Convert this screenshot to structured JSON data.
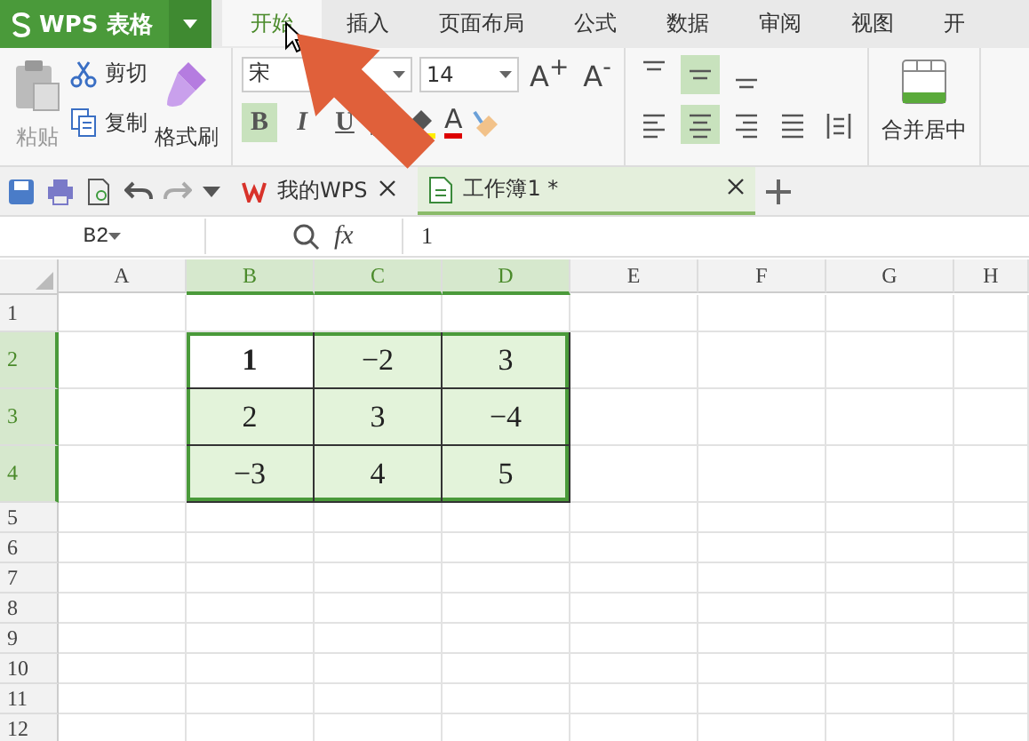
{
  "app": {
    "title": "WPS 表格"
  },
  "ribbon_tabs": [
    {
      "label": "开始",
      "selected": true
    },
    {
      "label": "插入",
      "selected": false
    },
    {
      "label": "页面布局",
      "selected": false
    },
    {
      "label": "公式",
      "selected": false
    },
    {
      "label": "数据",
      "selected": false
    },
    {
      "label": "审阅",
      "selected": false
    },
    {
      "label": "视图",
      "selected": false
    },
    {
      "label": "开",
      "selected": false
    }
  ],
  "clipboard": {
    "paste": "粘贴",
    "cut": "剪切",
    "copy": "复制",
    "format_painter": "格式刷"
  },
  "font": {
    "name": "宋",
    "size": "14",
    "grow": "A$^{+}$",
    "shrink": "A$^{-}$",
    "color_label": "A",
    "styles": [
      {
        "label": "B",
        "selected": true
      },
      {
        "label": "I",
        "selected": false
      },
      {
        "label": "U",
        "selected": false
      }
    ]
  },
  "alignment": {
    "vertical": [
      {
        "kind": "top",
        "selected": false
      },
      {
        "kind": "middle",
        "selected": true
      },
      {
        "kind": "bottom",
        "selected": false
      }
    ],
    "horizontal": [
      {
        "kind": "left",
        "selected": false
      },
      {
        "kind": "center",
        "selected": true
      },
      {
        "kind": "right",
        "selected": false
      },
      {
        "kind": "justify",
        "selected": false
      },
      {
        "kind": "distributed",
        "selected": false
      }
    ]
  },
  "merge": {
    "label": "合并居中"
  },
  "document_tabs": [
    {
      "label": "我的WPS",
      "selected": false
    },
    {
      "label": "工作簿1 *",
      "selected": true
    }
  ],
  "formula_bar": {
    "name_box": "B2",
    "fx": "fx",
    "value": "1"
  },
  "sheet": {
    "columns": [
      {
        "label": "A",
        "selected": false
      },
      {
        "label": "B",
        "selected": true
      },
      {
        "label": "C",
        "selected": true
      },
      {
        "label": "D",
        "selected": true
      },
      {
        "label": "E",
        "selected": false
      },
      {
        "label": "F",
        "selected": false
      },
      {
        "label": "G",
        "selected": false
      },
      {
        "label": "H",
        "selected": false
      }
    ],
    "rows": [
      {
        "label": "1",
        "selected": false
      },
      {
        "label": "2",
        "selected": true,
        "cells": [
          null,
          {
            "value": "1",
            "active": true
          },
          {
            "value": "−2",
            "active": false
          },
          {
            "value": "3",
            "active": false
          }
        ]
      },
      {
        "label": "3",
        "selected": true,
        "cells": [
          null,
          {
            "value": "2",
            "active": false
          },
          {
            "value": "3",
            "active": false
          },
          {
            "value": "−4",
            "active": false
          }
        ]
      },
      {
        "label": "4",
        "selected": true,
        "cells": [
          null,
          {
            "value": "−3",
            "active": false
          },
          {
            "value": "4",
            "active": false
          },
          {
            "value": "5",
            "active": false
          }
        ]
      },
      {
        "label": "5",
        "selected": false
      },
      {
        "label": "6",
        "selected": false
      },
      {
        "label": "7",
        "selected": false
      },
      {
        "label": "8",
        "selected": false
      },
      {
        "label": "9",
        "selected": false
      },
      {
        "label": "10",
        "selected": false
      },
      {
        "label": "11",
        "selected": false
      },
      {
        "label": "12",
        "selected": false
      }
    ]
  }
}
